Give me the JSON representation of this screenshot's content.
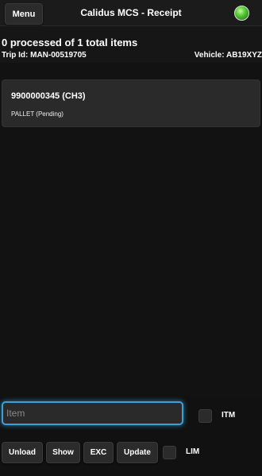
{
  "header": {
    "menu_label": "Menu",
    "title": "Calidus MCS - Receipt",
    "status_color": "#5fcf3a"
  },
  "summary": {
    "processed": "0 processed of 1 total items",
    "trip": "Trip Id: MAN-00519705",
    "vehicle": "Vehicle: AB19XYZ"
  },
  "items": [
    {
      "code": "9900000345 (CH3)",
      "status": "PALLET (Pending)"
    }
  ],
  "input": {
    "placeholder": "Item",
    "value": ""
  },
  "checkboxes": {
    "itm": {
      "label": "ITM",
      "checked": false
    },
    "lim": {
      "label": "LIM",
      "checked": false
    }
  },
  "buttons": {
    "unload": "Unload",
    "show": "Show",
    "exc": "EXC",
    "update": "Update"
  },
  "colors": {
    "background": "#111111",
    "accent": "#3aa0d8"
  }
}
